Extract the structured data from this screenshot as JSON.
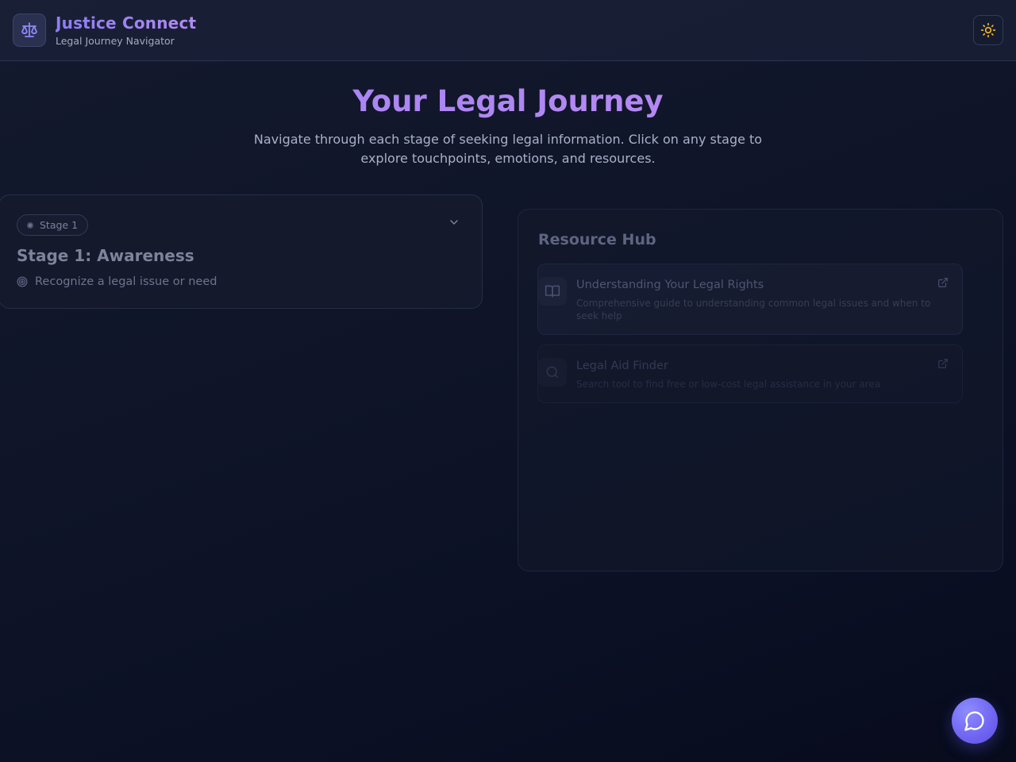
{
  "header": {
    "app_title": "Justice Connect",
    "app_subtitle": "Legal Journey Navigator",
    "logo_icon": "scales-of-justice-icon",
    "theme_toggle_icon": "sun-icon"
  },
  "hero": {
    "title": "Your Legal Journey",
    "description": "Navigate through each stage of seeking legal information. Click on any stage to explore touchpoints, emotions, and resources."
  },
  "stages": [
    {
      "badge": "Stage 1",
      "title": "Stage 1: Awareness",
      "goal": "Recognize a legal issue or need",
      "expand_icon": "chevron-down-icon"
    }
  ],
  "resource_hub": {
    "title": "Resource Hub",
    "resources": [
      {
        "title": "Understanding Your Legal Rights",
        "description": "Comprehensive guide to understanding common legal issues and when to seek help",
        "icon": "book-open-icon"
      },
      {
        "title": "Legal Aid Finder",
        "description": "Search tool to find free or low-cost legal assistance in your area",
        "icon": "search-icon"
      }
    ]
  },
  "chat": {
    "icon": "chat-bubble-icon"
  },
  "colors": {
    "accent_start": "#8f7cf6",
    "accent_end": "#c08cf0",
    "sun": "#f5b72a",
    "fab": "#6f64f2",
    "background": "#0f1428"
  }
}
